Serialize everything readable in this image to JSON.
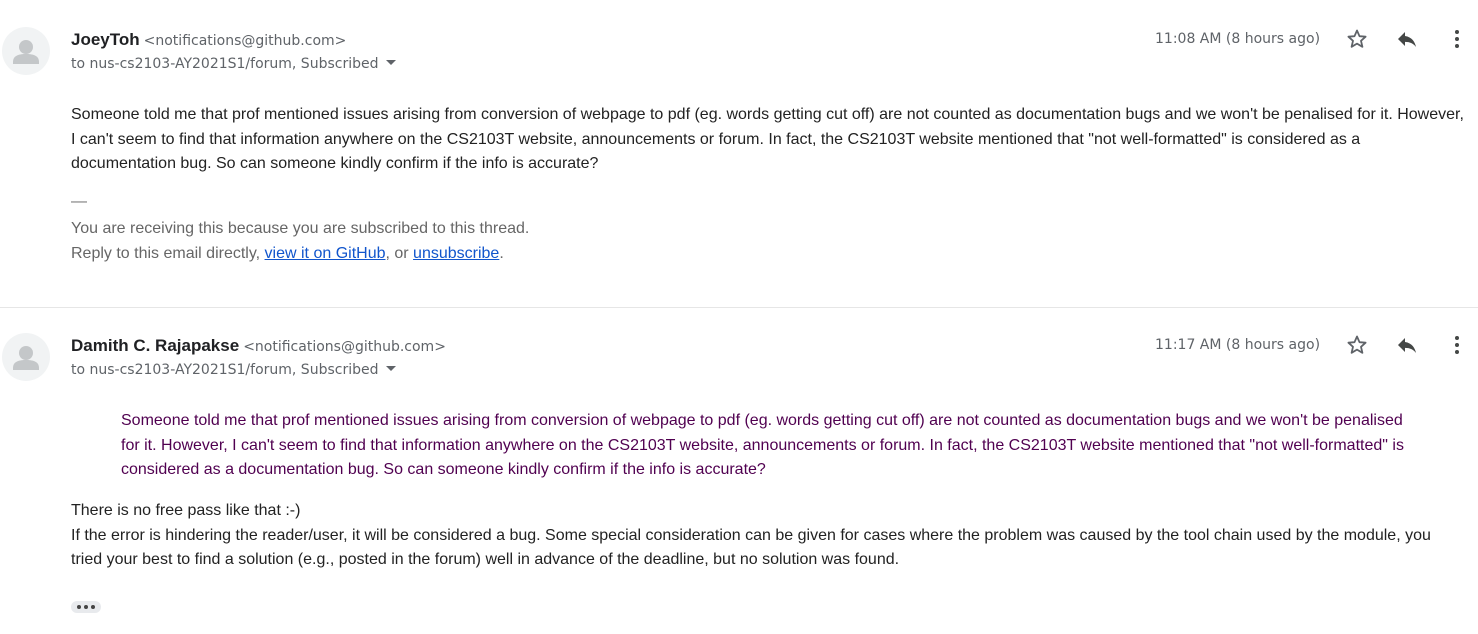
{
  "messages": [
    {
      "sender_name": "JoeyToh",
      "sender_email": "<notifications@github.com>",
      "recipient": "to nus-cs2103-AY2021S1/forum, Subscribed",
      "timestamp": "11:08 AM (8 hours ago)",
      "body": "Someone told me that prof mentioned issues arising from conversion of webpage to pdf (eg. words getting cut off) are not counted as documentation bugs and we won't be penalised for it. However, I can't seem to find that information anywhere on the CS2103T website, announcements or forum. In fact, the CS2103T website mentioned that \"not well-formatted\" is considered as a documentation bug. So can someone kindly confirm if the info is accurate?",
      "separator": "—",
      "footer_line1": "You are receiving this because you are subscribed to this thread.",
      "footer_prefix": "Reply to this email directly, ",
      "footer_link1": "view it on GitHub",
      "footer_middle": ", or ",
      "footer_link2": "unsubscribe",
      "footer_suffix": "."
    },
    {
      "sender_name": "Damith C. Rajapakse",
      "sender_email": "<notifications@github.com>",
      "recipient": "to nus-cs2103-AY2021S1/forum, Subscribed",
      "timestamp": "11:17 AM (8 hours ago)",
      "quote": "Someone told me that prof mentioned issues arising from conversion of webpage to pdf (eg. words getting cut off) are not counted as documentation bugs and we won't be penalised for it. However, I can't seem to find that information anywhere on the CS2103T website, announcements or forum. In fact, the CS2103T website mentioned that \"not well-formatted\" is considered as a documentation bug. So can someone kindly confirm if the info is accurate?",
      "reply_line1": "There is no free pass like that :-)",
      "reply_line2": "If the error is hindering the reader/user, it will be considered a bug. Some special consideration can be given for cases where the problem was caused by the tool chain used by the module, you tried your best to find a solution (e.g., posted in the forum) well in advance of the deadline, but no solution was found."
    }
  ],
  "icons": {
    "avatar": "default-avatar-icon",
    "star": "star-outline-icon",
    "reply": "reply-arrow-icon",
    "more": "more-vertical-icon",
    "expand": "ellipsis-icon"
  },
  "colors": {
    "quote_text": "#500050",
    "link": "#1155cc",
    "secondary_text": "#5f6368",
    "footer_text": "#666666"
  }
}
